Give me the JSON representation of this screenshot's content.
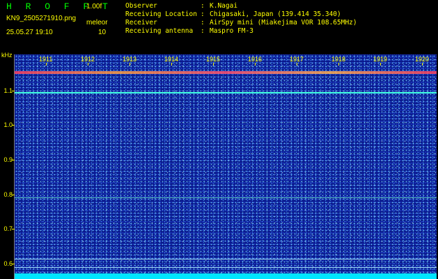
{
  "app": {
    "title": "H R O F F T",
    "version": "1.00f",
    "filename": "KN9_2505271910.png",
    "mode": "meleor",
    "datetime": "25.05.27 19:10",
    "count": "10"
  },
  "info": [
    {
      "label": "Observer",
      "value": "K.Nagai"
    },
    {
      "label": "Receiving Location",
      "value": "Chigasaki, Japan (139.414 35.340)"
    },
    {
      "label": "Receiver",
      "value": "AirSpy mini (Miakejima VOR 108.65MHz)"
    },
    {
      "label": "Receiving antenna",
      "value": "Maspro FM-3"
    }
  ],
  "separator": ":",
  "axis": {
    "y_unit": "kHz",
    "y_ticks": [
      "1.1",
      "1.0",
      "0.9",
      "0.8",
      "0.7",
      "0.6"
    ],
    "x_ticks": [
      "1911",
      "1912",
      "1913",
      "1914",
      "1915",
      "1916",
      "1917",
      "1918",
      "1919",
      "1920"
    ]
  },
  "colors": {
    "background": "#000000",
    "label": "#ffff00",
    "title": "#00ff00",
    "waterfall": "#0a1a8c",
    "signal": "#40ffe0"
  }
}
